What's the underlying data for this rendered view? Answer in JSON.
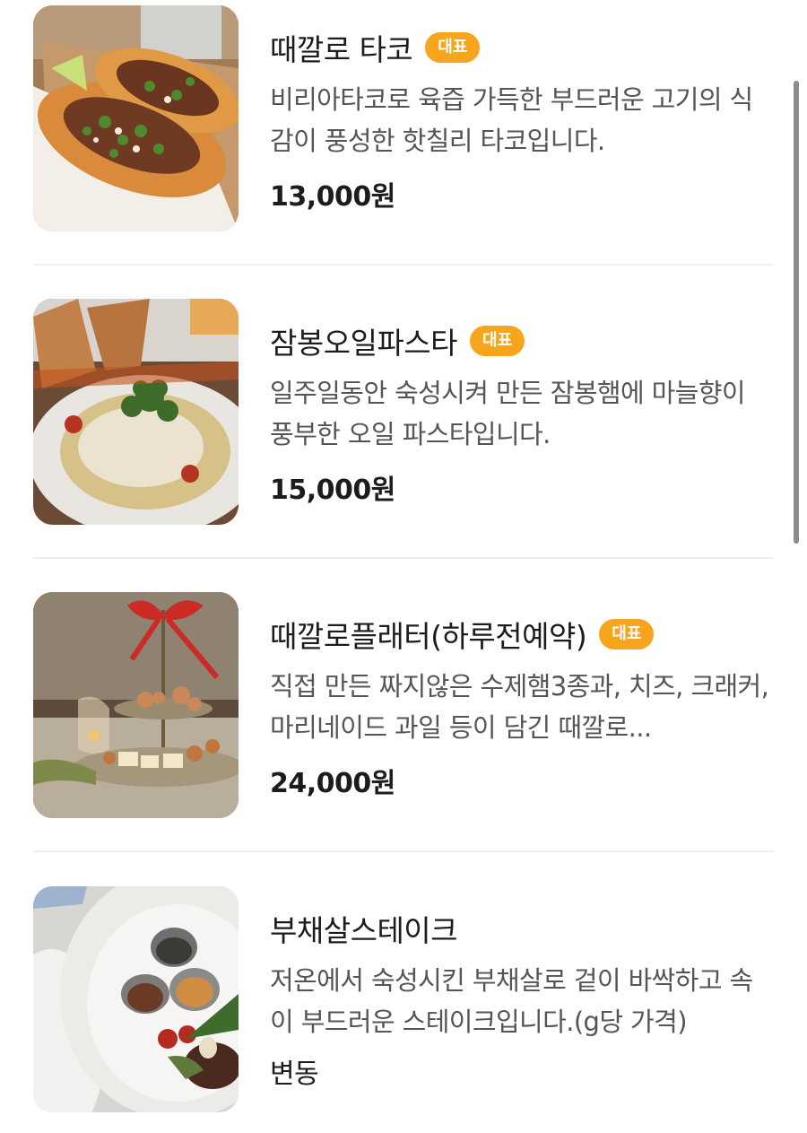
{
  "menu": {
    "items": [
      {
        "title": "때깔로 타코",
        "badge": "대표",
        "description": "비리아타코로 육즙 가득한 부드러운 고기의 식감이 풍성한 핫칠리 타코입니다.",
        "price": "13,000원",
        "image": "taco-photo"
      },
      {
        "title": "잠봉오일파스타",
        "badge": "대표",
        "description": "일주일동안 숙성시켜 만든 잠봉햄에 마늘향이 풍부한 오일 파스타입니다.",
        "price": "15,000원",
        "image": "pasta-photo"
      },
      {
        "title": "때깔로플래터(하루전예약)",
        "badge": "대표",
        "description": "직접 만든 짜지않은 수제햄3종과, 치즈, 크래커, 마리네이드 과일 등이 담긴 때깔로...",
        "price": "24,000원",
        "image": "platter-photo"
      },
      {
        "title": "부채살스테이크",
        "badge": "",
        "description": "저온에서 숙성시킨 부채살로 겉이 바싹하고 속이 부드러운 스테이크입니다.(g당 가격)",
        "price": "변동",
        "image": "steak-photo"
      }
    ]
  },
  "colors": {
    "badge": "#f7a51c",
    "divider": "#efefef",
    "scrollbar": "#8c8c8c"
  }
}
